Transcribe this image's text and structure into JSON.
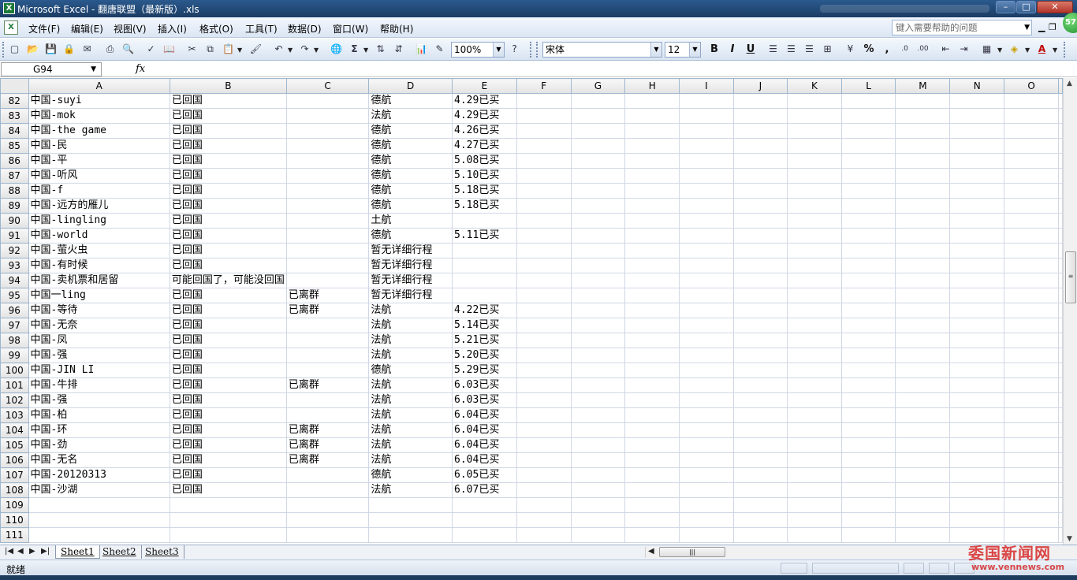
{
  "window": {
    "title": "Microsoft Excel - 翻唐联盟（最新版）.xls",
    "app_icon": "X"
  },
  "menu": {
    "items": [
      "文件(F)",
      "编辑(E)",
      "视图(V)",
      "插入(I)",
      "格式(O)",
      "工具(T)",
      "数据(D)",
      "窗口(W)",
      "帮助(H)"
    ],
    "help_placeholder": "键入需要帮助的问题"
  },
  "toolbar": {
    "zoom": "100%",
    "font_name": "宋体",
    "font_size": "12",
    "bold": "B",
    "italic": "I",
    "underline": "U",
    "percent": "%",
    "comma": ",",
    "sum": "Σ"
  },
  "formula_bar": {
    "name_box": "G94",
    "fx_label": "fx"
  },
  "grid": {
    "columns": [
      "A",
      "B",
      "C",
      "D",
      "E",
      "F",
      "G",
      "H",
      "I",
      "J",
      "K",
      "L",
      "M",
      "N",
      "O"
    ],
    "rows": [
      {
        "n": "82",
        "a": "中国-suyi",
        "b": "已回国",
        "c": "",
        "d": "德航",
        "e": "4.29已买"
      },
      {
        "n": "83",
        "a": "中国-mok",
        "b": "已回国",
        "c": "",
        "d": "法航",
        "e": "4.29已买"
      },
      {
        "n": "84",
        "a": "中国-the game",
        "b": "已回国",
        "c": "",
        "d": "德航",
        "e": "4.26已买"
      },
      {
        "n": "85",
        "a": "中国-民",
        "b": "已回国",
        "c": "",
        "d": "德航",
        "e": "4.27已买"
      },
      {
        "n": "86",
        "a": "中国-平",
        "b": "已回国",
        "c": "",
        "d": "德航",
        "e": "5.08已买"
      },
      {
        "n": "87",
        "a": "中国-听风",
        "b": "已回国",
        "c": "",
        "d": "德航",
        "e": "5.10已买"
      },
      {
        "n": "88",
        "a": "中国-f",
        "b": "已回国",
        "c": "",
        "d": "德航",
        "e": "5.18已买"
      },
      {
        "n": "89",
        "a": "中国-远方的雁儿",
        "b": "已回国",
        "c": "",
        "d": "德航",
        "e": "5.18已买"
      },
      {
        "n": "90",
        "a": "中国-lingling",
        "b": "已回国",
        "c": "",
        "d": "土航",
        "e": ""
      },
      {
        "n": "91",
        "a": "中国-world",
        "b": "已回国",
        "c": "",
        "d": "德航",
        "e": "5.11已买"
      },
      {
        "n": "92",
        "a": "中国-萤火虫",
        "b": "已回国",
        "c": "",
        "d": "暂无详细行程",
        "e": ""
      },
      {
        "n": "93",
        "a": "中国-有时候",
        "b": "已回国",
        "c": "",
        "d": "暂无详细行程",
        "e": ""
      },
      {
        "n": "94",
        "a": "中国-卖机票和居留",
        "b": "可能回国了，可能没回国",
        "c": "",
        "d": "暂无详细行程",
        "e": ""
      },
      {
        "n": "95",
        "a": "中国一ling",
        "b": "已回国",
        "c": "已离群",
        "d": "暂无详细行程",
        "e": ""
      },
      {
        "n": "96",
        "a": "中国-等待",
        "b": "已回国",
        "c": "已离群",
        "d": "法航",
        "e": "4.22已买"
      },
      {
        "n": "97",
        "a": "中国-无奈",
        "b": "已回国",
        "c": "",
        "d": "法航",
        "e": "5.14已买"
      },
      {
        "n": "98",
        "a": "中国-凤",
        "b": "已回国",
        "c": "",
        "d": "法航",
        "e": "5.21已买"
      },
      {
        "n": "99",
        "a": "中国-强",
        "b": "已回国",
        "c": "",
        "d": "法航",
        "e": "5.20已买"
      },
      {
        "n": "100",
        "a": "中国-JIN LI",
        "b": "已回国",
        "c": "",
        "d": "德航",
        "e": "5.29已买"
      },
      {
        "n": "101",
        "a": "中国-牛排",
        "b": "已回国",
        "c": "已离群",
        "d": "法航",
        "e": "6.03已买"
      },
      {
        "n": "102",
        "a": "中国-强",
        "b": "已回国",
        "c": "",
        "d": "法航",
        "e": "6.03已买"
      },
      {
        "n": "103",
        "a": "中国-柏",
        "b": "已回国",
        "c": "",
        "d": "法航",
        "e": "6.04已买"
      },
      {
        "n": "104",
        "a": "中国-环",
        "b": "已回国",
        "c": "已离群",
        "d": "法航",
        "e": "6.04已买"
      },
      {
        "n": "105",
        "a": "中国-劲",
        "b": "已回国",
        "c": "已离群",
        "d": "法航",
        "e": "6.04已买"
      },
      {
        "n": "106",
        "a": "中国-无名",
        "b": "已回国",
        "c": "已离群",
        "d": "法航",
        "e": "6.04已买"
      },
      {
        "n": "107",
        "a": "中国-20120313",
        "b": "已回国",
        "c": "",
        "d": "德航",
        "e": "6.05已买"
      },
      {
        "n": "108",
        "a": "中国-沙湖",
        "b": "已回国",
        "c": "",
        "d": "法航",
        "e": "6.07已买"
      },
      {
        "n": "109",
        "a": "",
        "b": "",
        "c": "",
        "d": "",
        "e": ""
      },
      {
        "n": "110",
        "a": "",
        "b": "",
        "c": "",
        "d": "",
        "e": ""
      },
      {
        "n": "111",
        "a": "",
        "b": "",
        "c": "",
        "d": "",
        "e": ""
      }
    ]
  },
  "sheets": [
    "Sheet1",
    "Sheet2",
    "Sheet3"
  ],
  "status": {
    "ready": "就绪"
  },
  "watermark": {
    "text": "委国新闻网",
    "url": "www.vennews.com"
  },
  "colors": {
    "titlebar": "#2b5a8e",
    "grid_border": "#d0d7e5",
    "watermark": "#d62828"
  }
}
